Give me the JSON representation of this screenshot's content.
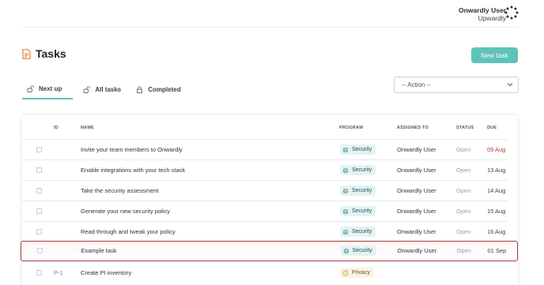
{
  "user": {
    "name": "Onwardly User",
    "organization": "Upwardly",
    "logo_icon": "org-ring-logo-icon"
  },
  "page": {
    "title": "Tasks",
    "title_icon": "document-icon"
  },
  "actions": {
    "new_task_label": "New task",
    "bulk_action_placeholder": "-- Action --"
  },
  "tabs": [
    {
      "label": "Next up",
      "icon": "unlock-icon",
      "active": true
    },
    {
      "label": "All tasks",
      "icon": "unlock-icon",
      "active": false
    },
    {
      "label": "Completed",
      "icon": "lock-icon",
      "active": false
    }
  ],
  "table": {
    "headers": {
      "id": "ID",
      "name": "NAME",
      "program": "PROGRAM",
      "assigned_to": "ASSIGNED TO",
      "status": "STATUS",
      "due": "DUE"
    },
    "rows": [
      {
        "id": "",
        "name": "Invite your team members to Onwardly",
        "program": "Security",
        "assigned_to": "Onwardly User",
        "status": "Open",
        "due": "09 Aug",
        "overdue": true
      },
      {
        "id": "",
        "name": "Enable integrations with your tech stack",
        "program": "Security",
        "assigned_to": "Onwardly User",
        "status": "Open",
        "due": "13 Aug"
      },
      {
        "id": "",
        "name": "Take the security assessment",
        "program": "Security",
        "assigned_to": "Onwardly User",
        "status": "Open",
        "due": "14 Aug"
      },
      {
        "id": "",
        "name": "Generate your new security policy",
        "program": "Security",
        "assigned_to": "Onwardly User",
        "status": "Open",
        "due": "15 Aug"
      },
      {
        "id": "",
        "name": "Read through and tweak your policy",
        "program": "Security",
        "assigned_to": "Onwardly User",
        "status": "Open",
        "due": "16 Aug"
      },
      {
        "id": "",
        "name": "Example task",
        "program": "Security",
        "assigned_to": "Onwardly User",
        "status": "Open",
        "due": "01 Sep",
        "highlighted": true
      },
      {
        "id": "P-1",
        "name": "Create PI inventory",
        "program": "Privacy",
        "assigned_to": "",
        "status": "",
        "due": ""
      }
    ]
  },
  "colors": {
    "accent": "#5ec3b7",
    "overdue": "#c0392b",
    "highlight_border": "#9b3e3b"
  }
}
